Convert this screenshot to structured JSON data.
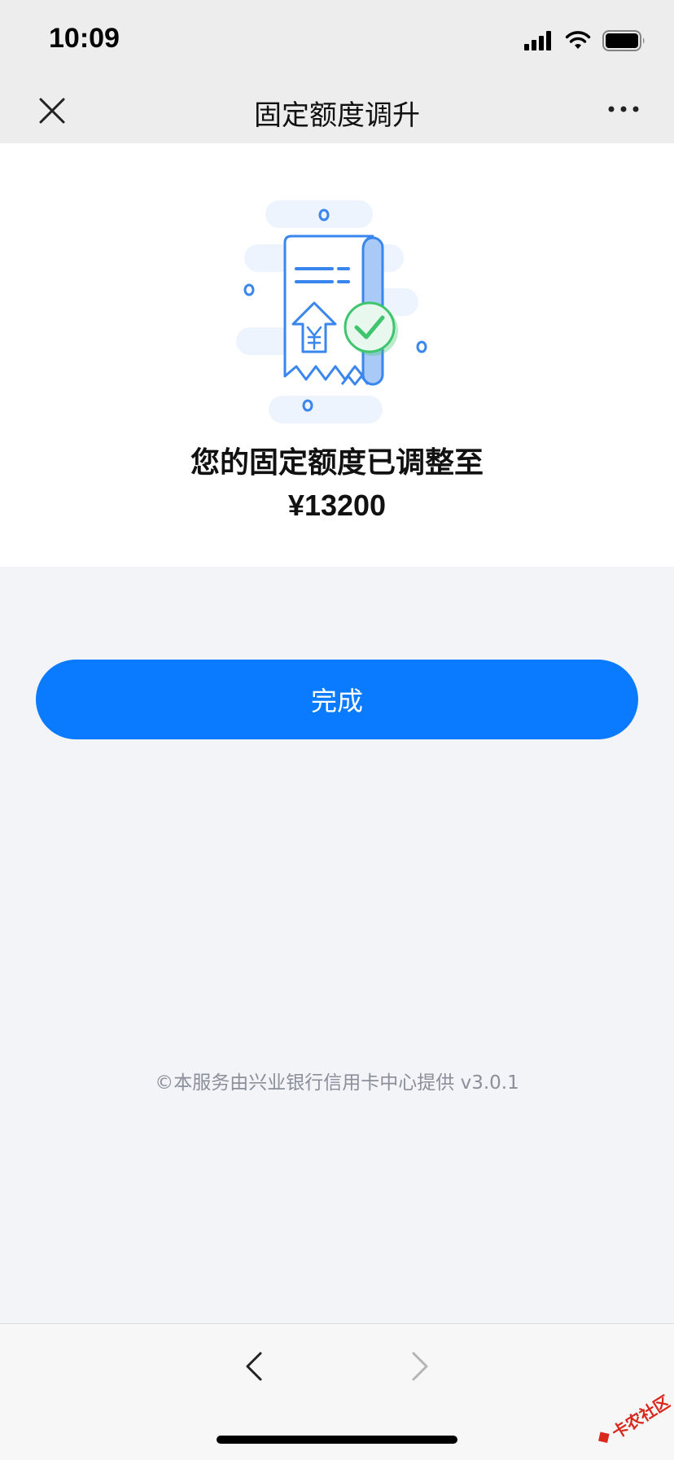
{
  "status_bar": {
    "time": "10:09"
  },
  "nav": {
    "title": "固定额度调升"
  },
  "result": {
    "message": "您的固定额度已调整至",
    "amount": "¥13200"
  },
  "actions": {
    "done_label": "完成"
  },
  "footer": {
    "text": "©本服务由兴业银行信用卡中心提供 v3.0.1"
  },
  "watermark": {
    "text": "卡农社区"
  },
  "colors": {
    "accent": "#0a7aff",
    "success": "#3ec56d",
    "illustration_blue": "#3a86ef"
  }
}
